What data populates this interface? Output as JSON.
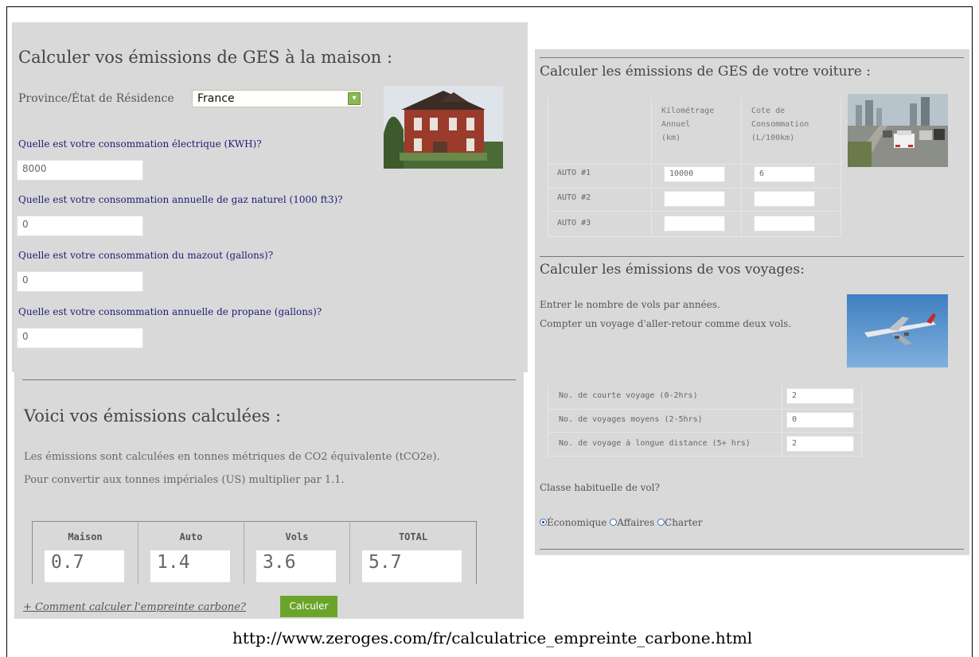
{
  "home": {
    "title": "Calculer vos émissions de GES à la maison :",
    "province_label": "Province/État de Résidence",
    "province_value": "France",
    "questions": [
      {
        "label": "Quelle est votre consommation électrique (KWH)?",
        "value": "8000"
      },
      {
        "label": "Quelle est votre consommation annuelle de gaz naturel (1000 ft3)?",
        "value": "0"
      },
      {
        "label": "Quelle est votre consommation du mazout (gallons)?",
        "value": "0"
      },
      {
        "label": "Quelle est votre consommation annuelle de propane (gallons)?",
        "value": "0"
      }
    ]
  },
  "results": {
    "title": "Voici vos émissions calculées :",
    "note_line1": "Les émissions sont calculées en tonnes métriques de CO2 équivalente (tCO2e).",
    "note_line2": "Pour convertir aux tonnes impériales (US) multiplier par 1.1.",
    "columns": [
      "Maison",
      "Auto",
      "Vols",
      "TOTAL"
    ],
    "values": [
      "0.7",
      "1.4",
      "3.6",
      "5.7"
    ],
    "how_link": "+ Comment calculer l'empreinte carbone?",
    "calc_button": "Calculer"
  },
  "car": {
    "title": "Calculer les émissions de GES de votre voiture :",
    "col_km": [
      "Kilométrage",
      "Annuel",
      "(km)"
    ],
    "col_rating": [
      "Cote de",
      "Consommation",
      "(L/100km)"
    ],
    "rows": [
      {
        "label": "AUTO #1",
        "km": "10000",
        "rating": "6"
      },
      {
        "label": "AUTO #2",
        "km": "",
        "rating": ""
      },
      {
        "label": "AUTO #3",
        "km": "",
        "rating": ""
      }
    ]
  },
  "travel": {
    "title": "Calculer les émissions de vos voyages:",
    "intro1": "Entrer le nombre de vols par années.",
    "intro2": "Compter un voyage d'aller-retour comme deux vols.",
    "rows": [
      {
        "label": "No. de courte voyage (0-2hrs)",
        "value": "2"
      },
      {
        "label": "No. de voyages moyens (2-5hrs)",
        "value": "0"
      },
      {
        "label": "No. de voyage à longue distance (5+ hrs)",
        "value": "2"
      }
    ],
    "class_question": "Classe habituelle de vol?",
    "class_options": [
      "Économique",
      "Affaires",
      "Charter"
    ],
    "class_selected": "Économique"
  },
  "caption_url": "http://www.zeroges.com/fr/calculatrice_empreinte_carbone.html",
  "colors": {
    "panel": "#d9d9d9",
    "question_text": "#1c1c7a",
    "calc_button": "#6aa52a"
  }
}
